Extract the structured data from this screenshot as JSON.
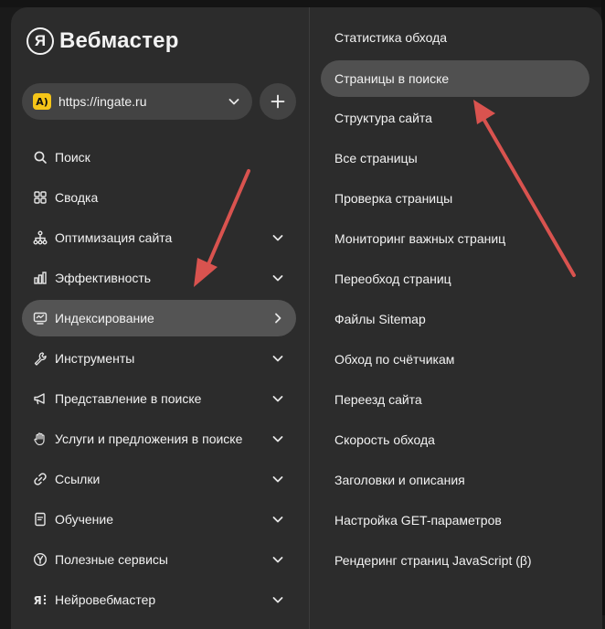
{
  "app": {
    "logo_letter": "Я",
    "title": "Вебмастер"
  },
  "site_select": {
    "favicon_text": "A)",
    "url": "https://ingate.ru"
  },
  "nav": {
    "items": [
      {
        "label": "Поиск"
      },
      {
        "label": "Сводка"
      },
      {
        "label": "Оптимизация сайта"
      },
      {
        "label": "Эффективность"
      },
      {
        "label": "Индексирование"
      },
      {
        "label": "Инструменты"
      },
      {
        "label": "Представление в поиске"
      },
      {
        "label": "Услуги и предложения в поиске"
      },
      {
        "label": "Ссылки"
      },
      {
        "label": "Обучение"
      },
      {
        "label": "Полезные сервисы"
      },
      {
        "label": "Нейровебмастер"
      }
    ]
  },
  "submenu": {
    "items": [
      {
        "label": "Статистика обхода"
      },
      {
        "label": "Страницы в поиске"
      },
      {
        "label": "Структура сайта"
      },
      {
        "label": "Все страницы"
      },
      {
        "label": "Проверка страницы"
      },
      {
        "label": "Мониторинг важных страниц"
      },
      {
        "label": "Переобход страниц"
      },
      {
        "label": "Файлы Sitemap"
      },
      {
        "label": "Обход по счётчикам"
      },
      {
        "label": "Переезд сайта"
      },
      {
        "label": "Скорость обхода"
      },
      {
        "label": "Заголовки и описания"
      },
      {
        "label": "Настройка GET-параметров"
      },
      {
        "label": "Рендеринг страниц JavaScript (β)"
      }
    ]
  },
  "colors": {
    "panel": "#2c2c2c",
    "active": "#545454",
    "annotation_arrow": "#d9534f",
    "favicon": "#f5c518"
  }
}
